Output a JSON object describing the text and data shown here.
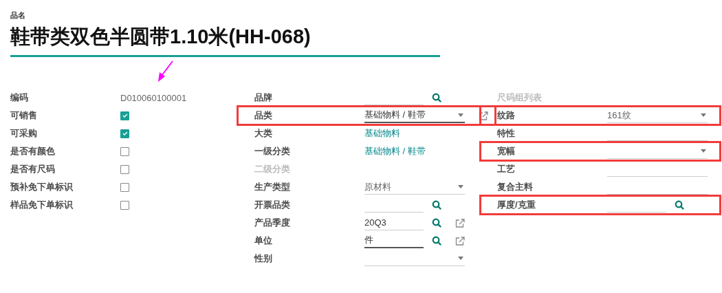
{
  "header": {
    "label": "品名",
    "title": "鞋带类双色半圆带1.10米(HH-068)"
  },
  "columns": [
    [
      {
        "label": "编码",
        "kind": "text",
        "value": "D010060100001"
      },
      {
        "label": "可销售",
        "kind": "checkbox",
        "checked": true
      },
      {
        "label": "可采购",
        "kind": "checkbox",
        "checked": true
      },
      {
        "label": "是否有颜色",
        "kind": "checkbox",
        "checked": false
      },
      {
        "label": "是否有尺码",
        "kind": "checkbox",
        "checked": false
      },
      {
        "label": "预补免下单标识",
        "kind": "checkbox",
        "checked": false
      },
      {
        "label": "样品免下单标识",
        "kind": "checkbox",
        "checked": false
      }
    ],
    [
      {
        "label": "品牌",
        "kind": "lookup",
        "external": false,
        "focused": false
      },
      {
        "label": "品类",
        "kind": "select",
        "value": "基础物料 / 鞋带",
        "external": true,
        "focused": true,
        "highlighted": true
      },
      {
        "label": "大类",
        "kind": "link",
        "value": "基础物料"
      },
      {
        "label": "一级分类",
        "kind": "link",
        "value": "基础物料 / 鞋带"
      },
      {
        "label": "二级分类",
        "kind": "disabled"
      },
      {
        "label": "生产类型",
        "kind": "select",
        "value": "原材料",
        "external": false,
        "focused": false
      },
      {
        "label": "开票品类",
        "kind": "lookup",
        "external": false,
        "focused": false
      },
      {
        "label": "产品季度",
        "kind": "lookup",
        "value": "20Q3",
        "external": true,
        "focused": false
      },
      {
        "label": "单位",
        "kind": "lookup",
        "value": "件",
        "external": true,
        "focused": true
      },
      {
        "label": "性别",
        "kind": "select",
        "external": false,
        "focused": false
      }
    ],
    [
      {
        "label": "尺码组列表",
        "kind": "disabled"
      },
      {
        "label": "纹路",
        "kind": "select",
        "value": "161纹",
        "external": false,
        "focused": false,
        "highlighted": true
      },
      {
        "label": "特性",
        "kind": "input"
      },
      {
        "label": "宽幅",
        "kind": "select",
        "external": false,
        "focused": false,
        "highlighted": true
      },
      {
        "label": "工艺",
        "kind": "input"
      },
      {
        "label": "复合主料",
        "kind": "input"
      },
      {
        "label": "厚度/克重",
        "kind": "lookup",
        "external": false,
        "focused": false,
        "highlighted": true
      }
    ]
  ]
}
